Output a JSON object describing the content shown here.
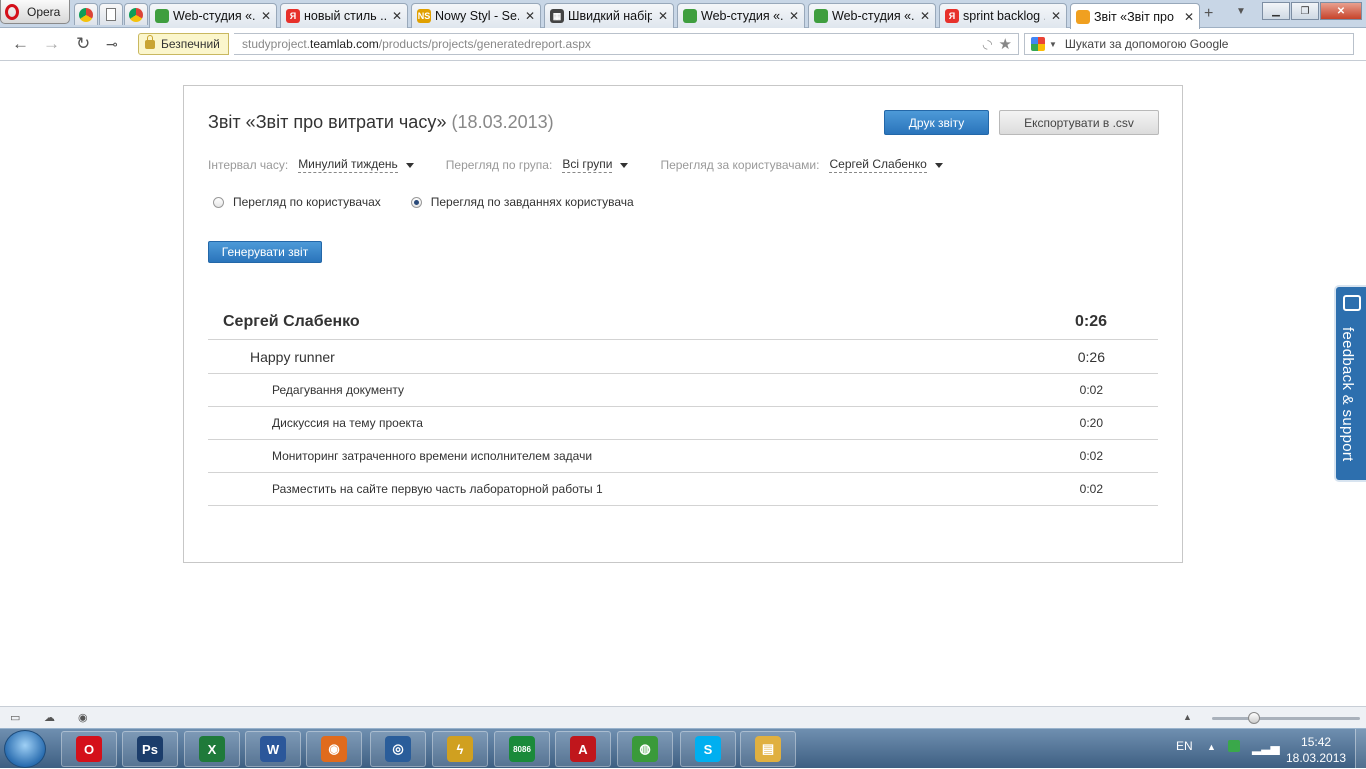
{
  "browser": {
    "opera_label": "Opera",
    "tabs": [
      {
        "title": "Web-студия «...",
        "fav_color": "#3f9e3f",
        "fav_text": ""
      },
      {
        "title": "новый стиль ...",
        "fav_color": "#e7312b",
        "fav_text": "Я"
      },
      {
        "title": "Nowy Styl - Se...",
        "fav_color": "#e0a000",
        "fav_text": "NS"
      },
      {
        "title": "Швидкий набір",
        "fav_color": "#444444",
        "fav_text": "▦"
      },
      {
        "title": "Web-студия «...",
        "fav_color": "#3f9e3f",
        "fav_text": ""
      },
      {
        "title": "Web-студия «...",
        "fav_color": "#3f9e3f",
        "fav_text": ""
      },
      {
        "title": "sprint backlog ...",
        "fav_color": "#e7312b",
        "fav_text": "Я"
      },
      {
        "title": "Звіт «Звіт про ...",
        "fav_color": "#f0a020",
        "fav_text": ""
      }
    ],
    "security_label": "Безпечний",
    "url_prefix": "studyproject.",
    "url_domain": "teamlab.com",
    "url_path": "/products/projects/generatedreport.aspx",
    "search_placeholder": "Шукати за допомогою Google"
  },
  "report": {
    "title": "Звіт «Звіт про витрати часу»",
    "date": "(18.03.2013)",
    "print_button": "Друк звіту",
    "export_button": "Експортувати в .csv",
    "filters": {
      "interval_label": "Інтервал часу:",
      "interval_value": "Минулий тиждень",
      "group_label": "Перегляд по група:",
      "group_value": "Всі групи",
      "user_label": "Перегляд за користувачами:",
      "user_value": "Сергей Слабенко"
    },
    "view_options": {
      "by_users": "Перегляд по користувачах",
      "by_tasks": "Перегляд по завданнях користувача",
      "selected": "by_tasks"
    },
    "generate_button": "Генерувати звіт",
    "user": {
      "name": "Сергей Слабенко",
      "time": "0:26"
    },
    "project": {
      "name": "Happy runner",
      "time": "0:26"
    },
    "tasks": [
      {
        "name": "Редагування документу",
        "time": "0:02"
      },
      {
        "name": "Дискуссия на тему проекта",
        "time": "0:20"
      },
      {
        "name": "Мониторинг затраченного времени исполнителем задачи",
        "time": "0:02"
      },
      {
        "name": "Разместить на сайте первую часть лабораторной работы 1",
        "time": "0:02"
      }
    ]
  },
  "feedback": {
    "label": "feedback & support"
  },
  "taskbar": {
    "apps": [
      {
        "name": "Opera",
        "color": "#d4101a",
        "text": "O"
      },
      {
        "name": "Photoshop",
        "color": "#1b3d6b",
        "text": "Ps"
      },
      {
        "name": "Excel",
        "color": "#1f7a3a",
        "text": "X"
      },
      {
        "name": "Word",
        "color": "#2b579a",
        "text": "W"
      },
      {
        "name": "Firefox",
        "color": "#e06b1d",
        "text": "◉"
      },
      {
        "name": "Emulator",
        "color": "#2a5d9a",
        "text": "◎"
      },
      {
        "name": "Winamp",
        "color": "#d0a020",
        "text": "ϟ"
      },
      {
        "name": "8086",
        "color": "#1a8a3a",
        "text": "8086"
      },
      {
        "name": "Acrobat",
        "color": "#c0161c",
        "text": "A"
      },
      {
        "name": "Chrome",
        "color": "#3a9a3a",
        "text": "◍"
      },
      {
        "name": "Skype",
        "color": "#00aff0",
        "text": "S"
      },
      {
        "name": "Explorer",
        "color": "#e0b040",
        "text": "▤"
      }
    ],
    "lang": "EN",
    "time": "15:42",
    "date": "18.03.2013"
  }
}
